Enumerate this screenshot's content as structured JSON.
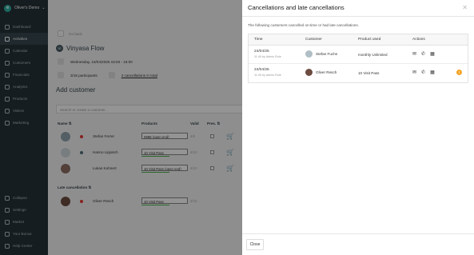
{
  "sidebar": {
    "org_name": "Oliver's Demo",
    "items": [
      {
        "label": "Dashboard",
        "icon": "dashboard-icon"
      },
      {
        "label": "Activities",
        "icon": "activities-icon"
      },
      {
        "label": "Calendar",
        "icon": "calendar-icon"
      },
      {
        "label": "Customers",
        "icon": "customers-icon"
      },
      {
        "label": "Financials",
        "icon": "financials-icon"
      },
      {
        "label": "Analytics",
        "icon": "analytics-icon"
      },
      {
        "label": "Products",
        "icon": "products-icon"
      },
      {
        "label": "Videos",
        "icon": "videos-icon"
      },
      {
        "label": "Marketing",
        "icon": "marketing-icon"
      }
    ],
    "bottom_items": [
      {
        "label": "Collapse",
        "icon": "collapse-icon"
      },
      {
        "label": "Settings",
        "icon": "settings-icon"
      },
      {
        "label": "Market",
        "icon": "market-icon"
      },
      {
        "label": "Your Bonus",
        "icon": "bonus-icon"
      },
      {
        "label": "Help Center",
        "icon": "help-icon"
      }
    ]
  },
  "main": {
    "back_label": "Go back",
    "activity_initials": "Vi",
    "activity_title": "Vinyasa Flow",
    "date": "Wednesday, 16/04/2025 15:00 - 16:00",
    "participants": "3/15 participants",
    "cancellations_link": "2 cancellations in total",
    "add_customer": "Add customer",
    "more": "More",
    "search_placeholder": "Search or create a customer...",
    "col_name": "Name ⇅",
    "col_products": "Products",
    "col_valid": "Valid",
    "col_pres": "Pres. ⇅",
    "rows": [
      {
        "name": "Stefan Ferrer",
        "product": "0988 (open end)",
        "valid": "4/5"
      },
      {
        "name": "Hanno Lippisch",
        "product": "10 Visit Pass",
        "valid": "4/10"
      },
      {
        "name": "Lukas Kuhnert",
        "product": "10 Visit Pass (open end)",
        "valid": "4/10"
      }
    ],
    "late_cancellation": "Late cancellation ⇅",
    "late_row": {
      "name": "Oliver Resch",
      "product": "10 Visit Pass",
      "valid": "4/10"
    }
  },
  "drawer": {
    "title": "Cancellations and late cancellations",
    "subtitle": "The following customers cancelled on-time or had late cancellations.",
    "headers": {
      "time": "Time",
      "customer": "Customer",
      "product": "Product used",
      "actions": "Actions"
    },
    "rows": [
      {
        "date": "24/04/25",
        "by": "11:49 by Admin Role",
        "customer": "Stefan Fuchs",
        "product": "monthly Unlimited",
        "warning": false
      },
      {
        "date": "24/04/25",
        "by": "11:49 by Admin Role",
        "customer": "Oliver Resch",
        "product": "10 Visit Pass",
        "warning": true
      }
    ],
    "close_label": "Close"
  },
  "colors": {
    "sidebar_bg": "#263238",
    "accent": "#2bb3a5",
    "warning": "#f4a62a",
    "cart": "#2e7d32"
  }
}
